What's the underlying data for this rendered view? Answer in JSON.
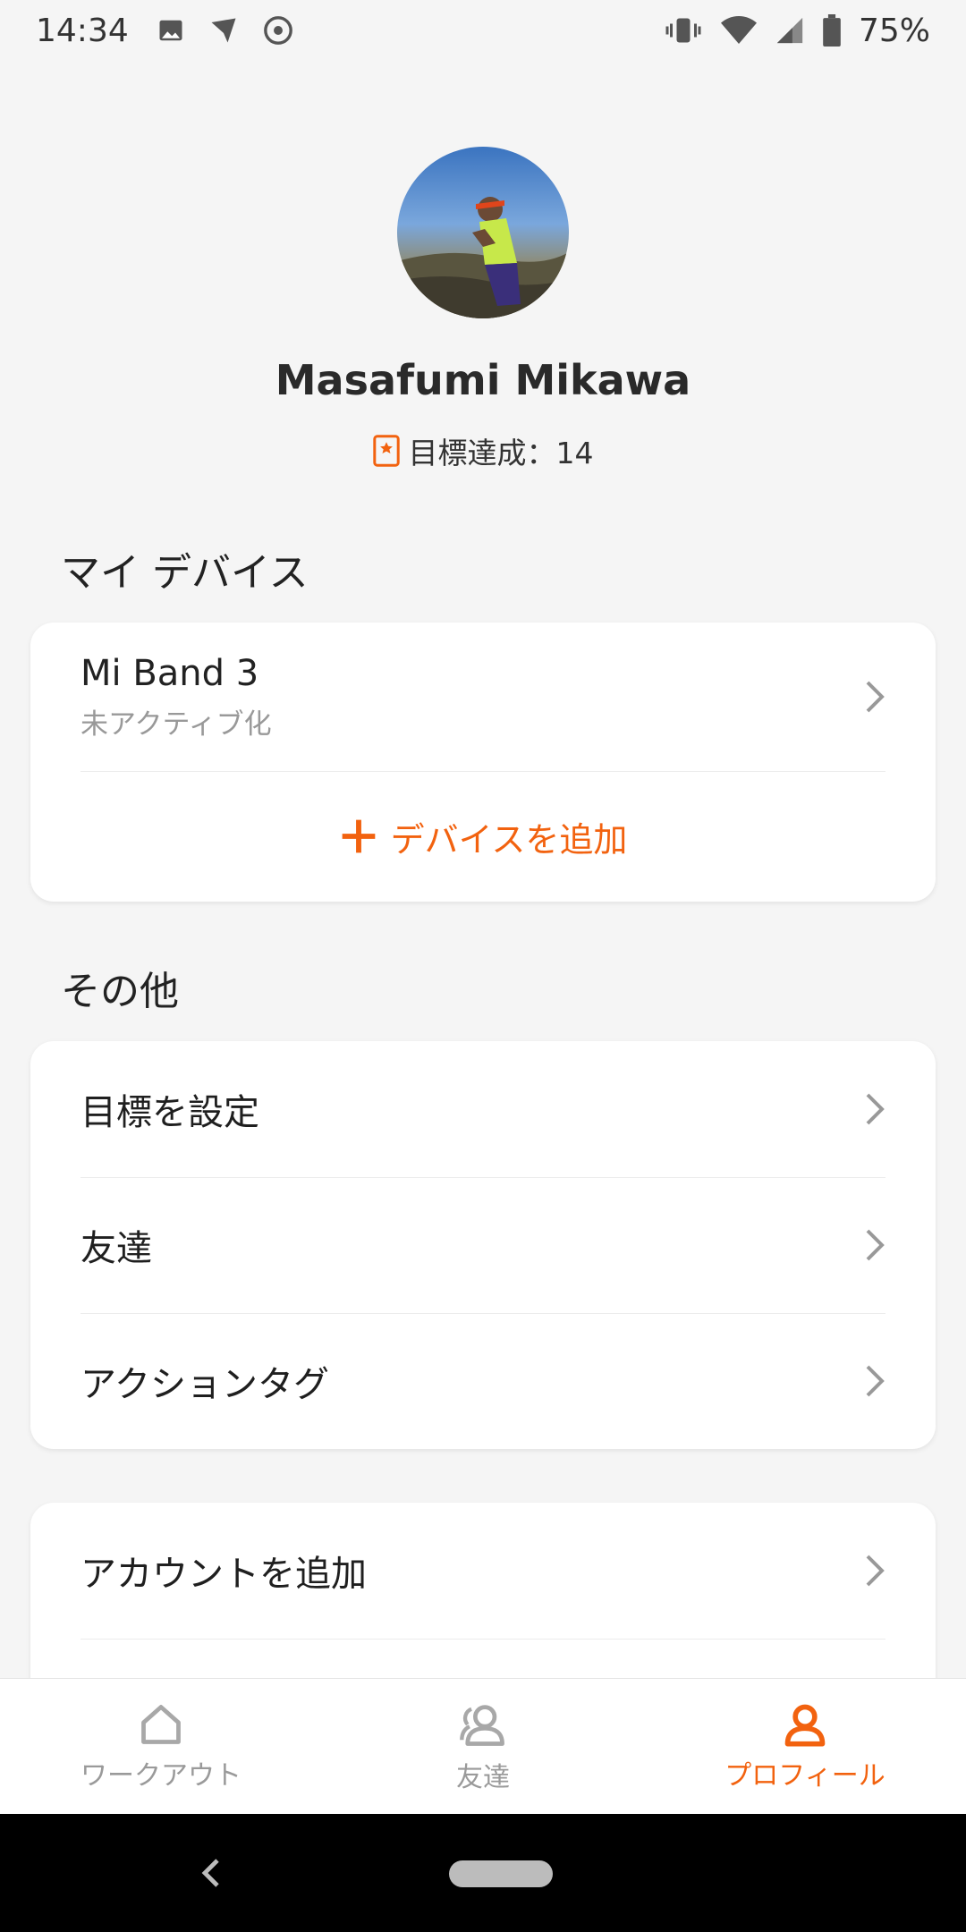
{
  "status_bar": {
    "time": "14:34",
    "battery": "75%"
  },
  "profile": {
    "name": "Masafumi Mikawa",
    "goal_label": "目標達成：14"
  },
  "my_devices": {
    "title": "マイ デバイス",
    "device": {
      "name": "Mi Band 3",
      "status": "未アクティブ化"
    },
    "add_label": "デバイスを追加"
  },
  "others": {
    "title": "その他",
    "items": [
      "目標を設定",
      "友達",
      "アクションタグ"
    ]
  },
  "account": {
    "items": [
      "アカウントを追加"
    ]
  },
  "bottom_nav": {
    "items": [
      {
        "label": "ワークアウト",
        "icon": "house-icon"
      },
      {
        "label": "友達",
        "icon": "friends-icon"
      },
      {
        "label": "プロフィール",
        "icon": "person-icon"
      }
    ],
    "active": "プロフィール"
  },
  "colors": {
    "accent": "#f2620f",
    "background": "#f5f5f5",
    "card": "#ffffff",
    "muted": "#999999"
  }
}
